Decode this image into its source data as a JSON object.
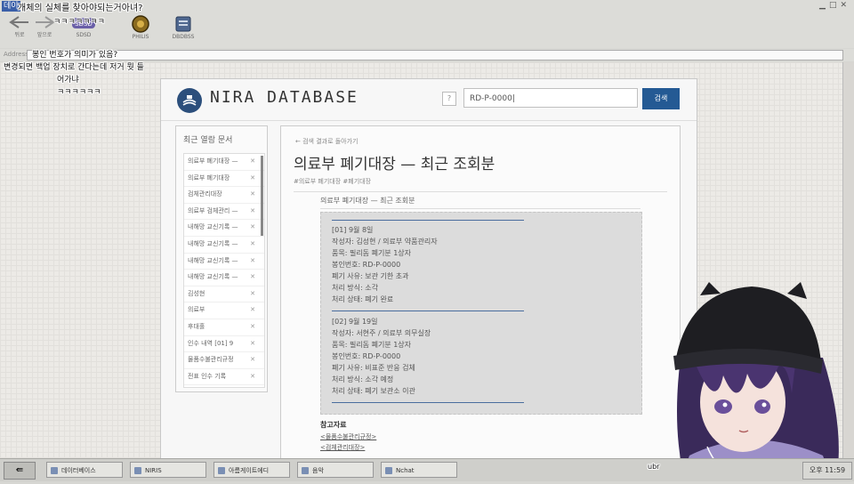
{
  "window": {
    "chip": "데이",
    "title": "개체의 실체를 찾아야되는거아녀?"
  },
  "toolbar": {
    "items": [
      {
        "icon": "back-arrow-icon",
        "label": "뒤로"
      },
      {
        "icon": "forward-arrow-icon",
        "label": "앞으로"
      },
      {
        "icon": "sdsd-logo-icon",
        "label": "SDSD"
      },
      {
        "icon": "emblem-icon",
        "label": "PHILIS"
      },
      {
        "icon": "database-icon",
        "label": "DBDBSS"
      }
    ]
  },
  "address": {
    "label": "Address"
  },
  "captions": {
    "c1": "ㅋㅋㅋㅋㅋㅋㅋ",
    "c2": "봉인 번호가 의미가 있음?",
    "c3": "변경되면 백업 장치로 간다는데 저거 뭣 들",
    "c4": "어가냐",
    "c5": "ㅋㅋㅋㅋㅋㅋ"
  },
  "site": {
    "brand": "NIRA DATABASE",
    "help": "?",
    "search_value": "RD-P-0000|",
    "search_button": "검색"
  },
  "recent": {
    "title": "최근 열람 문서",
    "items": [
      "의료부 폐기대장 —",
      "의료부 폐기대장",
      "검체관리대장",
      "의료부 검체관리 —",
      "내해망 교신기록 —",
      "내해망 교신기록 —",
      "내해망 교신기록 —",
      "내해망 교신기록 —",
      "김성현",
      "의료부",
      "후대홀",
      "인수 내역 [01] 9",
      "물품수불관리규정",
      "전표 인수 기록"
    ]
  },
  "article": {
    "back": "← 검색 결과로 돌아가기",
    "title": "의료부 폐기대장 — 최근 조회분",
    "tags": "#의료부 폐기대장  #폐기대장",
    "subtitle": "의료부 폐기대장 — 최근 조회분",
    "records": [
      {
        "lines": [
          "[01] 9월 8일",
          "작성자: 김성현 / 의료부 약품관리자",
          "품목: 필리돔 폐기분 1상자",
          "봉인번호: RD-P-0000",
          "폐기 사유: 보관 기한 초과",
          "처리 방식: 소각",
          "처리 상태: 폐기 완료"
        ]
      },
      {
        "lines": [
          "[02] 9월 19일",
          "작성자: 서현주 / 의료부 의무실장",
          "품목: 필리돔 폐기분 1상자",
          "봉인번호: RD-P-0000",
          "폐기 사유: 비표준 반응 검체",
          "처리 방식: 소각 예정",
          "처리 상태: 폐기 보관소 이관"
        ]
      }
    ],
    "refs_title": "참고자료",
    "refs": [
      "<물품수불관리규정>",
      "<검체관리대장>"
    ]
  },
  "taskbar": {
    "start_icon": "⇚",
    "tasks": [
      "데이터베이스",
      "NIRIS",
      "아름게이트에디",
      "음악",
      "Nchat"
    ],
    "tray_prefix": "ubr",
    "clock": "오후 11:59"
  },
  "colors": {
    "accent": "#245a94",
    "record_rule": "#4a6d9e",
    "record_bg": "#dcdcdc"
  }
}
